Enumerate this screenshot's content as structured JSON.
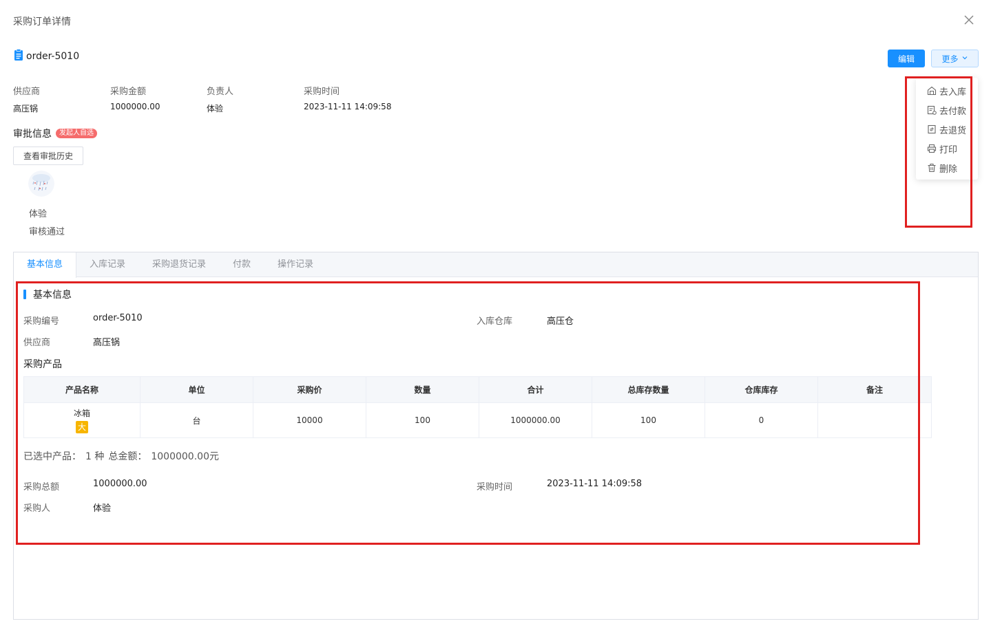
{
  "dialog": {
    "title": "采购订单详情"
  },
  "order": {
    "id": "order-5010"
  },
  "actions": {
    "edit_label": "编辑",
    "more_label": "更多"
  },
  "more_menu": [
    {
      "label": "去入库",
      "icon": "warehouse-in-icon"
    },
    {
      "label": "去付款",
      "icon": "payment-icon"
    },
    {
      "label": "去退货",
      "icon": "return-icon"
    },
    {
      "label": "打印",
      "icon": "printer-icon"
    },
    {
      "label": "删除",
      "icon": "trash-icon"
    }
  ],
  "summary": [
    {
      "label": "供应商",
      "value": "高压锅"
    },
    {
      "label": "采购金额",
      "value": "1000000.00"
    },
    {
      "label": "负责人",
      "value": "体验"
    },
    {
      "label": "采购时间",
      "value": "2023-11-11 14:09:58"
    }
  ],
  "approval": {
    "title": "审批信息",
    "badge": "发起人自选",
    "history_button": "查看审批历史",
    "approver": "体验",
    "status": "审核通过"
  },
  "tabs": [
    "基本信息",
    "入库记录",
    "采购退货记录",
    "付款",
    "操作记录"
  ],
  "basic_info": {
    "title": "基本信息",
    "order_no": {
      "label": "采购编号",
      "value": "order-5010"
    },
    "warehouse": {
      "label": "入库仓库",
      "value": "高压仓"
    },
    "supplier": {
      "label": "供应商",
      "value": "高压锅"
    },
    "products_title": "采购产品",
    "table": {
      "headers": [
        "产品名称",
        "单位",
        "采购价",
        "数量",
        "合计",
        "总库存数量",
        "仓库库存",
        "备注"
      ],
      "rows": [
        {
          "name": "冰箱",
          "tag": "大",
          "unit": "台",
          "price": "10000",
          "qty": "100",
          "total": "1000000.00",
          "stock_total": "100",
          "warehouse_stock": "0",
          "remark": ""
        }
      ]
    },
    "selected_summary": {
      "prefix": "已选中产品：",
      "count": "1 种",
      "amount_label": "总金额：",
      "amount": "1000000.00元"
    },
    "total_amount": {
      "label": "采购总额",
      "value": "1000000.00"
    },
    "purchase_time": {
      "label": "采购时间",
      "value": "2023-11-11 14:09:58"
    },
    "purchaser": {
      "label": "采购人",
      "value": "体验"
    }
  },
  "colors": {
    "primary": "#1890ff",
    "danger": "#f56c6c",
    "highlight_box": "#e02020",
    "tag": "#f7b500"
  }
}
